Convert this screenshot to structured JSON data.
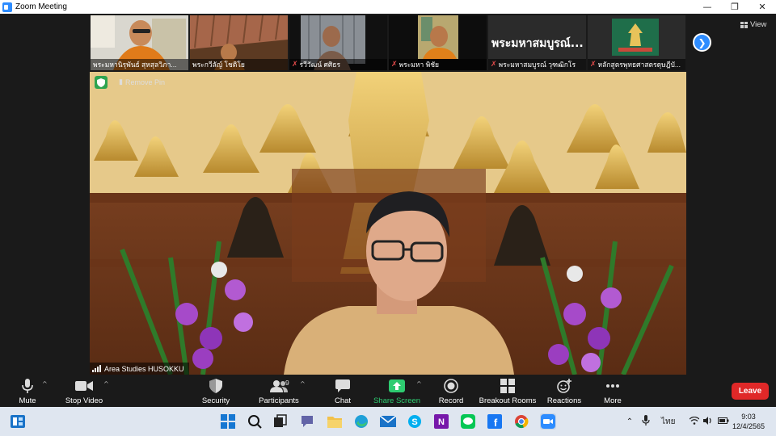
{
  "window": {
    "title": "Zoom Meeting",
    "controls": [
      "minimize-icon",
      "maximize-icon",
      "close-icon"
    ]
  },
  "view": {
    "label": "View"
  },
  "participants_strip": [
    {
      "name": "พระมหานิรุพันธ์ สุหสุลวิภา...",
      "muted": false,
      "tile_text": ""
    },
    {
      "name": "พระกวีลัญ์ โชติโย",
      "muted": false,
      "tile_text": ""
    },
    {
      "name": "รวีวัฒน์ ศศิธร",
      "muted": true,
      "tile_text": ""
    },
    {
      "name": "พระมหา พิชัย",
      "muted": true,
      "tile_text": ""
    },
    {
      "name": "พระมหาสมบูรณ์ วุฑฒิกโร",
      "muted": true,
      "tile_text": "พระมหาสมบูรณ์..."
    },
    {
      "name": "หลักสูตรพุทธศาสตรดุษฎีบั...",
      "muted": true,
      "tile_text": ""
    }
  ],
  "main_video": {
    "remove_pin": "Remove Pin",
    "speaker_name": "Area Studies HUSOKKU"
  },
  "toolbar": {
    "items": [
      {
        "label": "Mute",
        "icon": "microphone-icon",
        "has_caret": true
      },
      {
        "label": "Stop Video",
        "icon": "video-camera-icon",
        "has_caret": true
      },
      {
        "label": "Security",
        "icon": "shield-icon",
        "has_caret": false
      },
      {
        "label": "Participants",
        "icon": "participants-icon",
        "has_caret": true,
        "count": "9"
      },
      {
        "label": "Chat",
        "icon": "chat-icon",
        "has_caret": false
      },
      {
        "label": "Share Screen",
        "icon": "share-screen-icon",
        "has_caret": true
      },
      {
        "label": "Record",
        "icon": "record-icon",
        "has_caret": false
      },
      {
        "label": "Breakout Rooms",
        "icon": "breakout-rooms-icon",
        "has_caret": false
      },
      {
        "label": "Reactions",
        "icon": "reactions-icon",
        "has_caret": false
      },
      {
        "label": "More",
        "icon": "more-icon",
        "has_caret": false
      }
    ],
    "leave_label": "Leave"
  },
  "taskbar": {
    "apps": [
      "start-icon",
      "search-icon",
      "task-view-icon",
      "teams-chat-icon",
      "file-explorer-icon",
      "edge-icon",
      "mail-icon",
      "skype-icon",
      "onenote-icon",
      "line-icon",
      "facebook-icon",
      "chrome-icon",
      "zoom-icon"
    ],
    "tray": {
      "language": "ไทย"
    },
    "clock": {
      "time": "9:03",
      "date": "12/4/2565"
    }
  },
  "colors": {
    "zoom_blue": "#2d8cff",
    "leave_red": "#e02828",
    "share_green": "#2ecc71",
    "mute_red": "#e24a4a"
  }
}
